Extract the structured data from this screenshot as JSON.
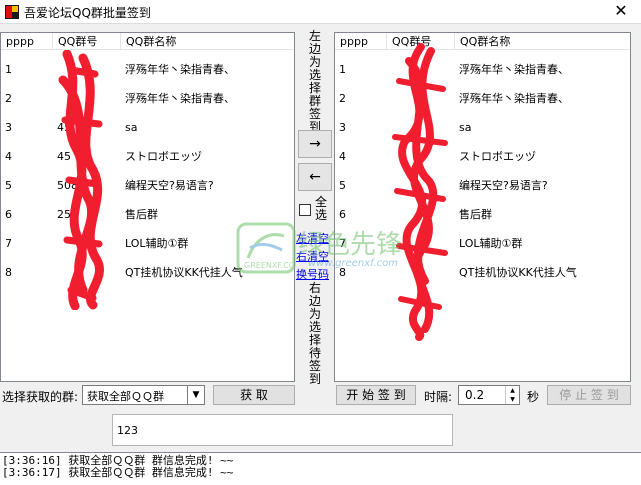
{
  "window": {
    "title": "吾爱论坛QQ群批量签到",
    "close_glyph": "✕"
  },
  "list_left": {
    "columns": [
      "pppp",
      "QQ群号",
      "QQ群名称"
    ],
    "rows": [
      {
        "num": "1",
        "qq": "",
        "name": "浮殇年华丶染指青春、"
      },
      {
        "num": "2",
        "qq": "",
        "name": "浮殇年华丶染指青春、"
      },
      {
        "num": "3",
        "qq": "45",
        "name": "sa"
      },
      {
        "num": "4",
        "qq": "45",
        "name": "ストロボエッヅ"
      },
      {
        "num": "5",
        "qq": "508",
        "name": "编程天空?易语言?"
      },
      {
        "num": "6",
        "qq": "257",
        "name": "售后群"
      },
      {
        "num": "7",
        "qq": "",
        "name": "LOL辅助①群"
      },
      {
        "num": "8",
        "qq": "",
        "name": "QT挂机协议KK代挂人气"
      }
    ]
  },
  "list_right": {
    "columns": [
      "pppp",
      "QQ群号",
      "QQ群名称"
    ],
    "rows": [
      {
        "num": "1",
        "qq": "",
        "name": "浮殇年华丶染指青春、"
      },
      {
        "num": "2",
        "qq": "",
        "name": "浮殇年华丶染指青春、"
      },
      {
        "num": "3",
        "qq": "",
        "name": "sa"
      },
      {
        "num": "4",
        "qq": "",
        "name": "ストロボエッヅ"
      },
      {
        "num": "5",
        "qq": "",
        "name": "编程天空?易语言?"
      },
      {
        "num": "6",
        "qq": "",
        "name": "售后群"
      },
      {
        "num": "7",
        "qq": "",
        "name": "LOL辅助①群"
      },
      {
        "num": "8",
        "qq": "",
        "name": "QT挂机协议KK代挂人气"
      }
    ]
  },
  "middle": {
    "label_top": "左边为选择群签到",
    "move_right": "→",
    "move_left": "←",
    "select_all": "全选",
    "link_clear_left": "左清空",
    "link_clear_right": "右清空",
    "link_swap": "换号码",
    "label_bottom": "右边为选择待签到"
  },
  "controls": {
    "group_label": "选择获取的群:",
    "group_select": "获取全部ＱＱ群",
    "fetch_button": "获 取",
    "start_button": "开 始 签 到",
    "interval_label": "时隔:",
    "interval_value": "0.2",
    "seconds_label": "秒",
    "stop_button": "停 止 签 到",
    "message_value": "123"
  },
  "log": [
    "[3:36:16] 获取全部ＱＱ群 群信息完成! ~~",
    "[3:36:17] 获取全部ＱＱ群 群信息完成! ~~"
  ],
  "watermark": {
    "brand": "绿色先锋",
    "url": "www.greenxf.com",
    "badge": "GREENXF.COM"
  },
  "colors": {
    "scribble": "#f01e2e",
    "link": "#0000ee",
    "watermark": "#6cc06a"
  }
}
